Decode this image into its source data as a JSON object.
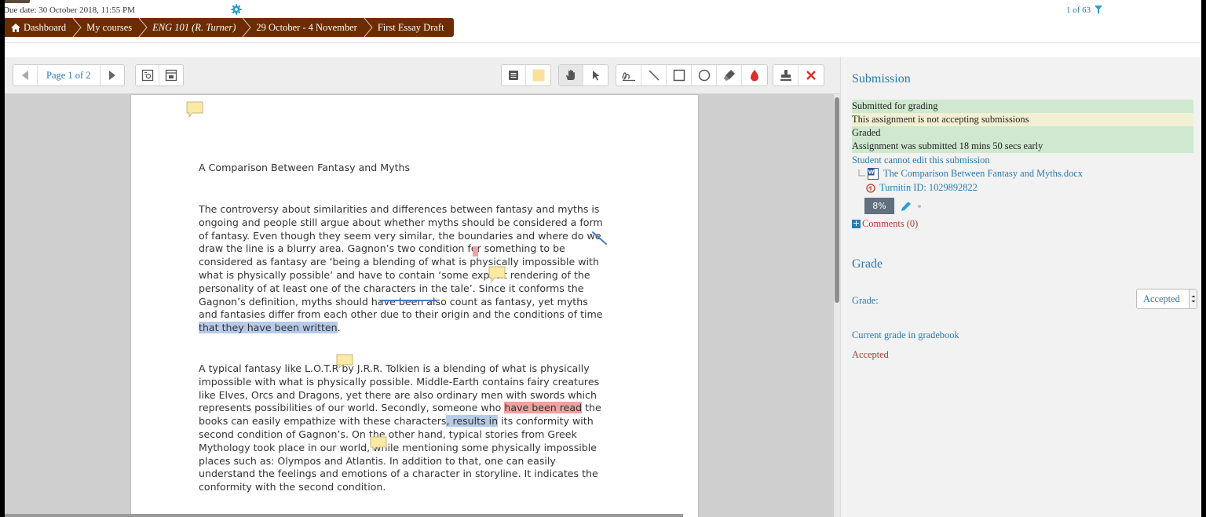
{
  "header": {
    "due_date": "Due date: 30 October 2018, 11:55 PM",
    "pager": "1 of 63"
  },
  "breadcrumb": [
    {
      "label": "Dashboard"
    },
    {
      "label": "My courses"
    },
    {
      "label": "ENG 101 (R. Turner)"
    },
    {
      "label": "29 October - 4 November"
    },
    {
      "label": "First Essay Draft"
    }
  ],
  "toolbar": {
    "page_label": "Page 1 of 2",
    "colors": {
      "comment_color": "#fbe9a6",
      "highlight_color": "#fbe09a",
      "pen_color": "#d9302c",
      "delete_color": "#e0302a"
    }
  },
  "document": {
    "title": "A Comparison Between Fantasy and Myths",
    "para1": [
      "The controversy about similarities and differences between fantasy and myths is",
      "ongoing and people still argue about whether myths should be considered a form",
      "of fantasy. Even though they seem very similar, the boundaries and where do we",
      "draw the line is a blurry area. Gagnon’s two condition for something to be",
      "considered as fantasy are ‘being a blending of what is physically impossible with",
      "what is physically possible’ and have to contain ‘some explicit rendering of the",
      "personality of at least one of the characters in the tale’. Since it conforms the",
      "Gagnon’s definition, myths should have been also count as fantasy, yet myths",
      "and fantasies differ from each other due to their origin and the conditions of time"
    ],
    "para1_last_hl": "that they have been written",
    "para1_last_tail": ".",
    "para2": [
      "A typical fantasy like L.O.T.R by J.R.R. Tolkien is a blending of what is physically",
      "impossible with what is physically possible. Middle-Earth contains fairy creatures",
      "like Elves, Orcs and Dragons, yet there are also ordinary men with swords which"
    ],
    "p2_line4_a": "represents possibilities of our world. Secondly, someone who ",
    "p2_line4_hl": "have been read",
    "p2_line4_b": " the",
    "p2_line5_a": "books can easily empathize with these characters",
    "p2_line5_hl": ", results in",
    "p2_line5_b": " its conformity with",
    "para2_rest": [
      "second condition of Gagnon’s.  On the other hand, typical stories from Greek",
      "Mythology took place in our world, while mentioning some physically impossible",
      "places such as: Olympos and Atlantis. In addition to that, one can easily",
      "understand the feelings and emotions of a character in storyline. It indicates the",
      "conformity with the second condition."
    ]
  },
  "panel": {
    "submission_heading": "Submission",
    "status_submitted": "Submitted for grading",
    "status_not_accepting": "This assignment is not accepting submissions",
    "status_graded": "Graded",
    "status_early": "Assignment was submitted 18 mins 50 secs early",
    "cannot_edit": "Student cannot edit this submission",
    "file_name": "The Comparison Between Fantasy and Myths.docx",
    "turnitin_id": "Turnitin ID: 1029892822",
    "similarity": "8%",
    "comments": "Comments (0)",
    "grade_heading": "Grade",
    "grade_label": "Grade:",
    "grade_value": "Accepted",
    "current_grade_label": "Current grade in gradebook",
    "current_grade_value": "Accepted"
  }
}
